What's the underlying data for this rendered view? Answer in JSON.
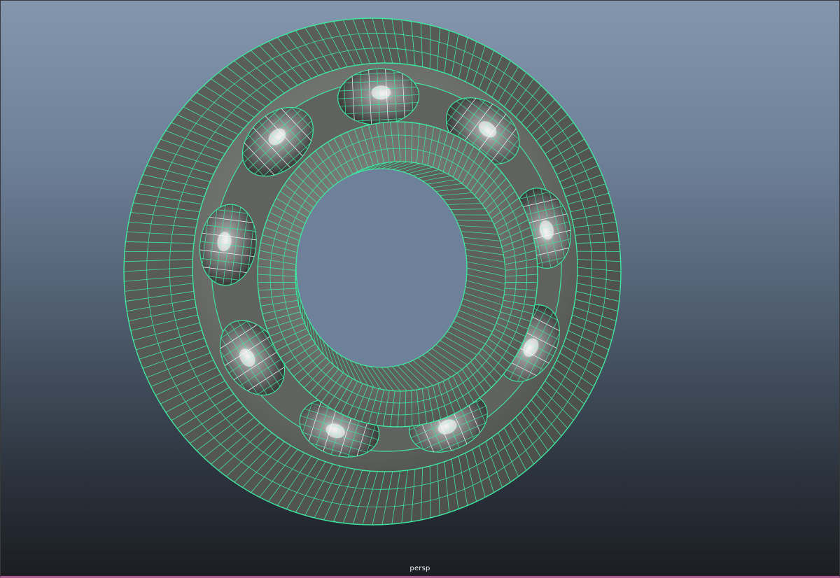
{
  "viewport": {
    "camera_name": "persp",
    "background_top": "#8496ae",
    "background_bottom": "#1a1d22",
    "wire_color": "#3fe6a0",
    "highlight_color": "#ffffff",
    "selection_border_color": "#b05f95"
  },
  "model": {
    "object": "ball-bearing",
    "ball_count": 9,
    "display_mode": "wireframe-on-shaded"
  }
}
